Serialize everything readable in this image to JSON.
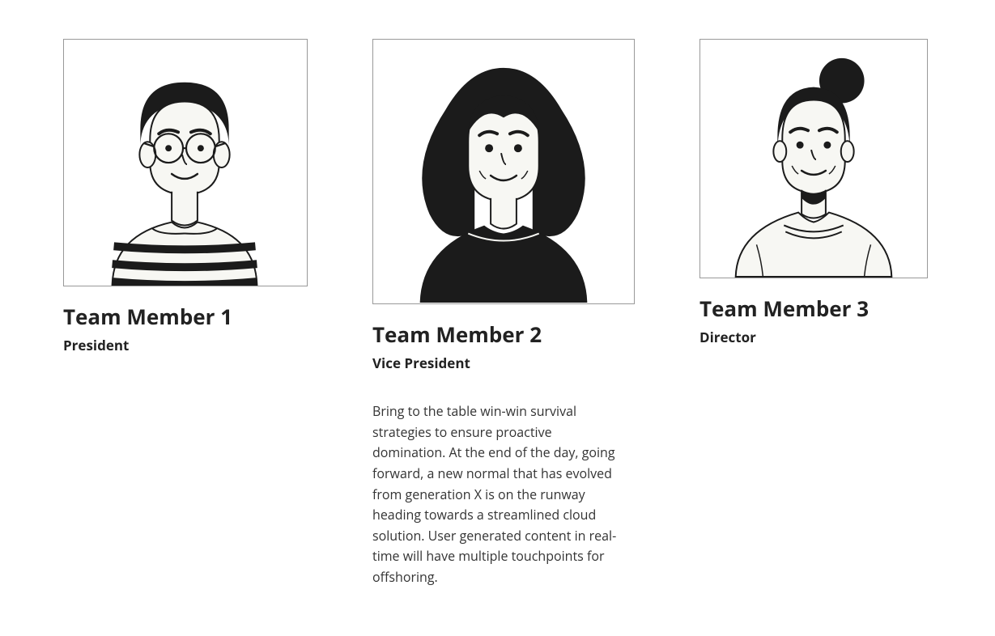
{
  "members": [
    {
      "name": "Team Member 1",
      "title": "President",
      "bio": ""
    },
    {
      "name": "Team Member 2",
      "title": "Vice President",
      "bio": "Bring to the table win-win survival strategies to ensure proactive domination. At the end of the day, going forward, a new normal that has evolved from generation X is on the runway heading towards a streamlined cloud solution. User generated content in real-time will have multiple touchpoints for offshoring."
    },
    {
      "name": "Team Member 3",
      "title": "Director",
      "bio": ""
    }
  ]
}
